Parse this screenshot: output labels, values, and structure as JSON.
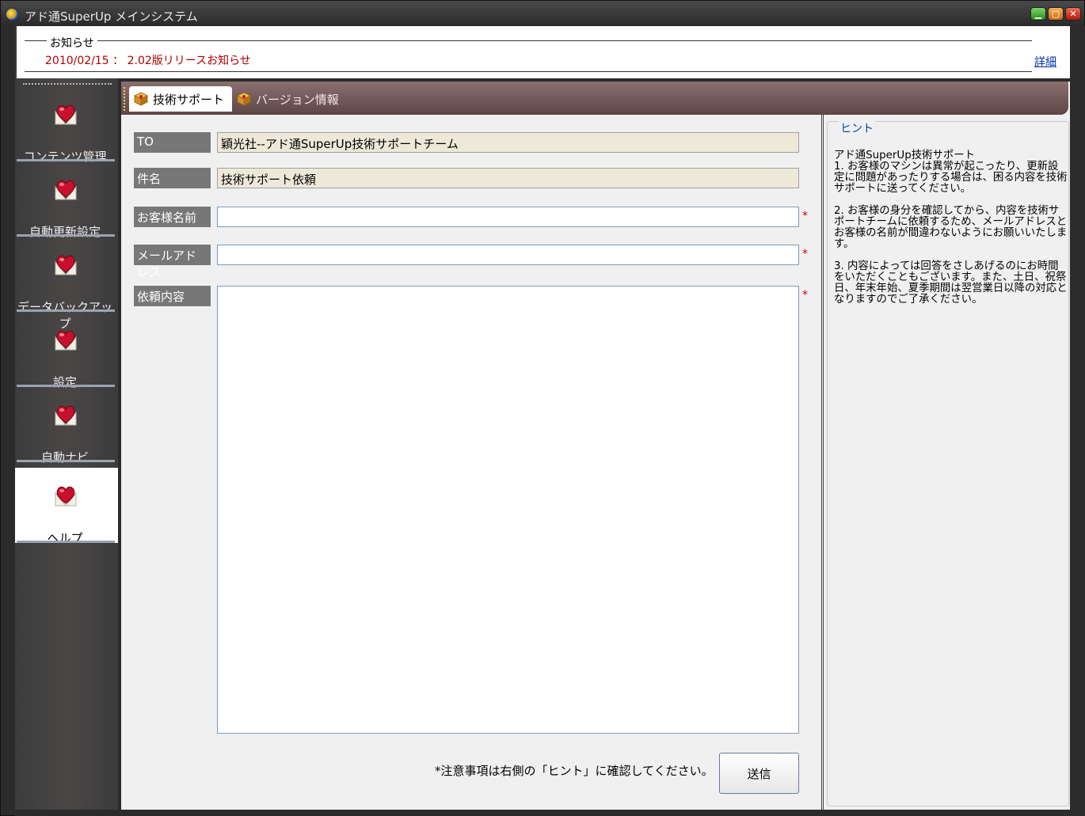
{
  "window": {
    "title": "アド通SuperUp メインシステム",
    "controls": [
      "minimize",
      "maximize",
      "close"
    ]
  },
  "news": {
    "legend": "お知らせ",
    "text": "2010/02/15 ： 2.02版リリースお知らせ",
    "detail_link": "詳細"
  },
  "sidebar": {
    "items": [
      {
        "label": "コンテンツ管理",
        "icon": "heart-envelope-icon",
        "active": false
      },
      {
        "label": "自動更新設定",
        "icon": "heart-envelope-icon",
        "active": false
      },
      {
        "label": "データバックアップ",
        "icon": "heart-envelope-icon",
        "active": false
      },
      {
        "label": "設定",
        "icon": "heart-envelope-icon",
        "active": false
      },
      {
        "label": "自動ナビ",
        "icon": "heart-envelope-icon",
        "active": false
      },
      {
        "label": "ヘルプ",
        "icon": "heart-envelope-icon",
        "active": true
      }
    ]
  },
  "tabs": [
    {
      "label": "技術サポート",
      "icon": "box-icon",
      "active": true
    },
    {
      "label": "バージョン情報",
      "icon": "box-icon",
      "active": false
    }
  ],
  "form": {
    "to_label": "TO",
    "to_value": "穎光社--アド通SuperUp技術サポートチーム",
    "subject_label": "件名",
    "subject_value": "技術サポート依頼",
    "name_label": "お客様名前",
    "name_value": "",
    "email_label": "メールアドレス",
    "email_value": "",
    "content_label": "依頼内容",
    "content_value": "",
    "required_mark": "*",
    "note": "*注意事項は右側の「ヒント」に確認してください。",
    "send_label": "送信"
  },
  "hint": {
    "legend": "ヒント",
    "text": "アド通SuperUp技術サポート\n1. お客様のマシンは異常が起こったり、更新設定に問題があったりする場合は、困る内容を技術サポートに送ってください。\n\n2. お客様の身分を確認してから、内容を技術サポートチームに依頼するため、メールアドレスとお客様の名前が間違わないようにお願いいたします。\n\n3. 内容によっては回答をさしあげるのにお時間をいただくこともございます。また、土日、祝祭日、年末年始、夏季期間は翌営業日以降の対応となりますのでご了承ください。"
  },
  "colors": {
    "sidebar_bg": "#3c3c3c",
    "tabbar_bg": "#6e5656",
    "news_text": "#b00000",
    "required": "#d00000",
    "link": "#0033aa",
    "hint_legend": "#0044aa"
  }
}
